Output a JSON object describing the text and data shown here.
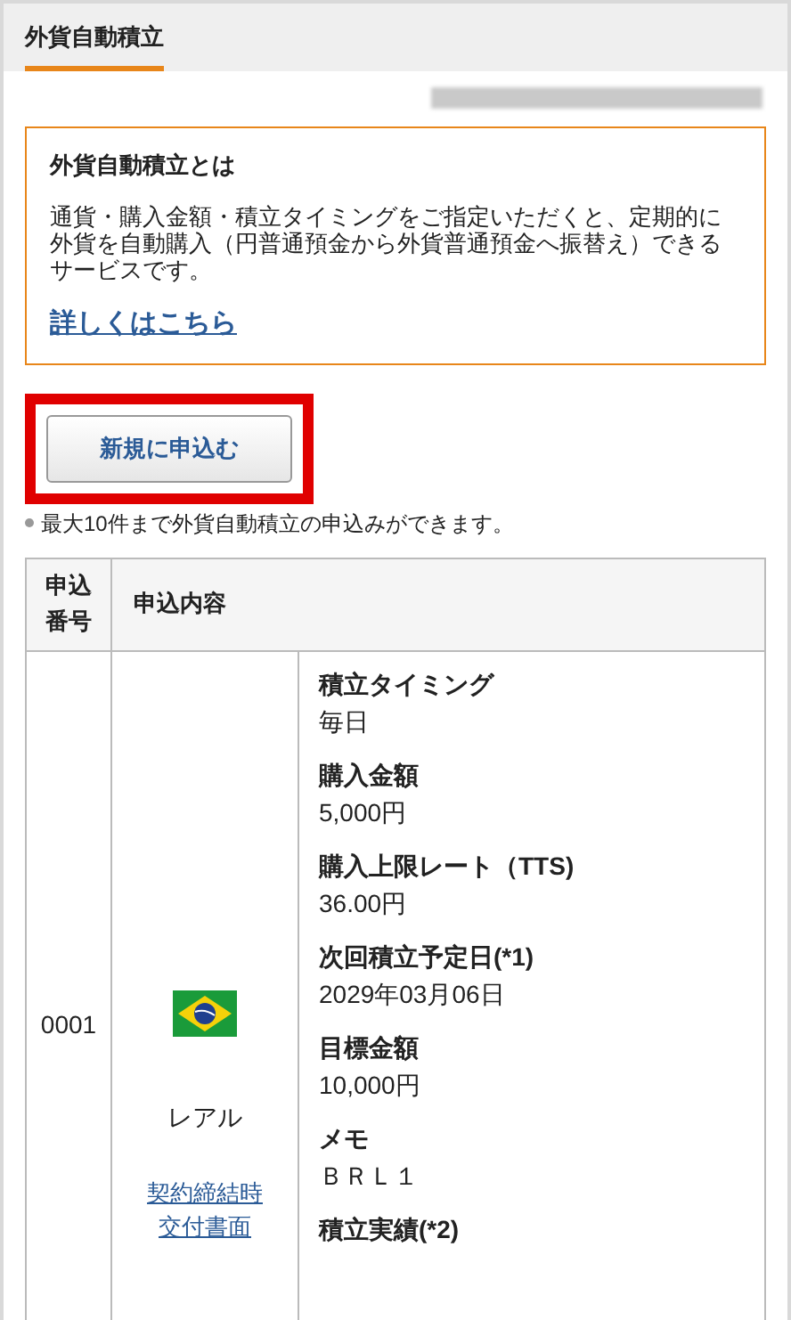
{
  "header": {
    "title": "外貨自動積立"
  },
  "info": {
    "title": "外貨自動積立とは",
    "body": "通貨・購入金額・積立タイミングをご指定いただくと、定期的に外貨を自動購入（円普通預金から外貨普通預金へ振替え）できるサービスです。",
    "link": "詳しくはこちら"
  },
  "apply_button": {
    "label": "新規に申込む",
    "highlighted": true
  },
  "note": "最大10件まで外貨自動積立の申込みができます。",
  "table": {
    "columns": [
      "申込番号",
      "申込内容"
    ],
    "rows": [
      {
        "number": "0001",
        "currency": "レアル",
        "document_link": "契約締結時交付書面",
        "details": [
          {
            "label": "積立タイミング",
            "value": "毎日"
          },
          {
            "label": "購入金額",
            "value": "5,000円"
          },
          {
            "label": "購入上限レート（TTS)",
            "value": "36.00円"
          },
          {
            "label": "次回積立予定日(*1)",
            "value": "2029年03月06日"
          },
          {
            "label": "目標金額",
            "value": "10,000円"
          },
          {
            "label": "メモ",
            "value": "ＢＲＬ１"
          },
          {
            "label": "積立実績(*2)"
          }
        ]
      }
    ]
  }
}
